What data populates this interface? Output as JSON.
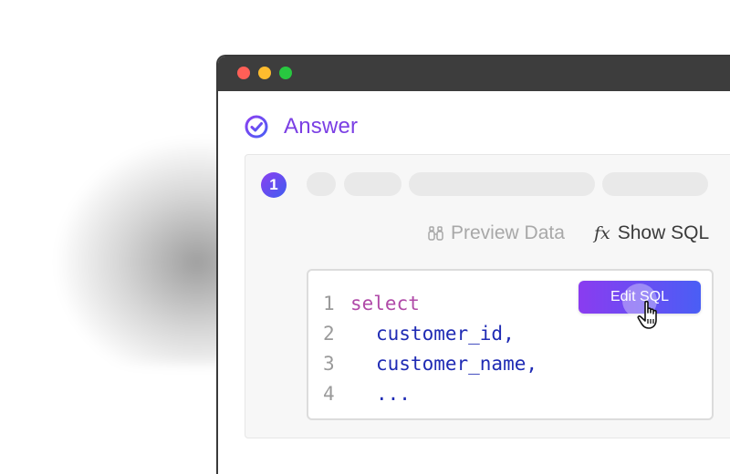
{
  "window": {
    "traffic_lights": [
      "close",
      "minimize",
      "maximize"
    ]
  },
  "answer": {
    "title": "Answer",
    "icon": "check-circle-icon"
  },
  "step": {
    "number": "1"
  },
  "actions": {
    "preview_label": "Preview Data",
    "preview_icon": "binoculars-icon",
    "show_sql_icon_text": "fx",
    "show_sql_label": "Show SQL"
  },
  "code": {
    "lines": [
      {
        "num": "1",
        "text": "select",
        "kind": "keyword"
      },
      {
        "num": "2",
        "text": "customer_id,",
        "kind": "identifier"
      },
      {
        "num": "3",
        "text": "customer_name,",
        "kind": "identifier"
      },
      {
        "num": "4",
        "text": "...",
        "kind": "identifier"
      }
    ],
    "edit_button_label": "Edit SQL"
  },
  "colors": {
    "accent": "#7b3fe4",
    "keyword": "#b04aa8",
    "identifier": "#1f2bb4"
  }
}
